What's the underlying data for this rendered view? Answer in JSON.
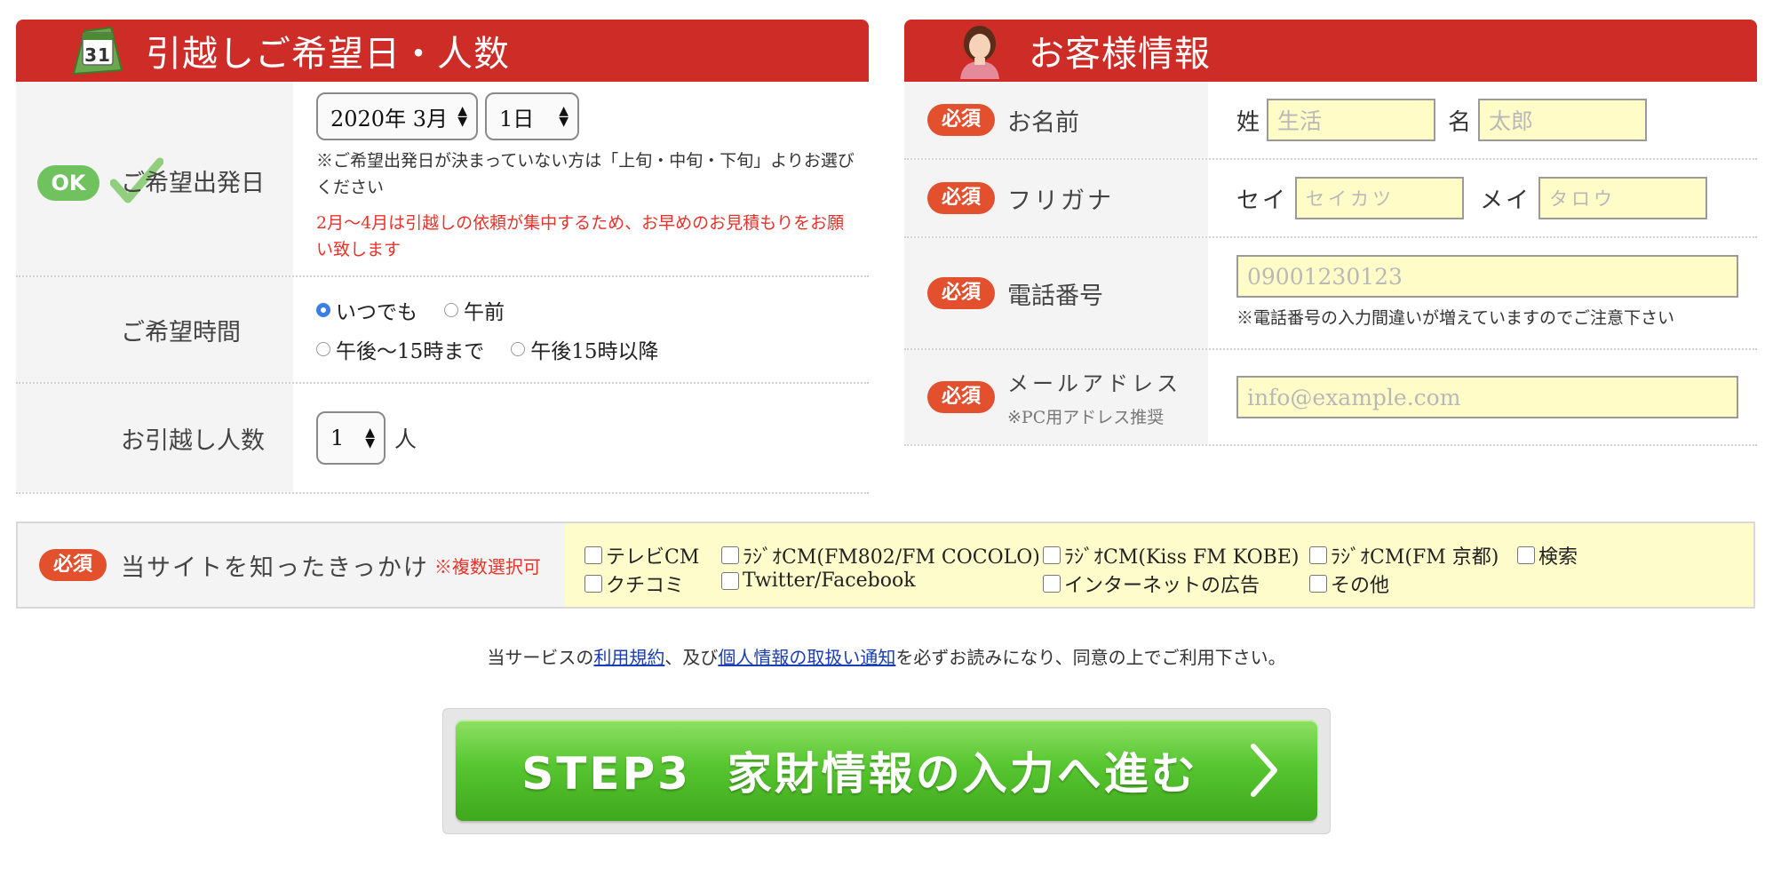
{
  "move": {
    "title": "引越しご希望日・人数",
    "departure": {
      "label": "ご希望出発日",
      "ok_badge": "OK",
      "year_month": "2020年 3月",
      "day": "1日",
      "note": "※ご希望出発日が決まっていない方は「上旬・中旬・下旬」よりお選びください",
      "warning": "2月〜4月は引越しの依頼が集中するため、お早めのお見積もりをお願い致します"
    },
    "time": {
      "label": "ご希望時間",
      "options": [
        "いつでも",
        "午前",
        "午後〜15時まで",
        "午後15時以降"
      ],
      "selected": "いつでも"
    },
    "people": {
      "label": "お引越し人数",
      "value": "1",
      "unit": "人"
    }
  },
  "customer": {
    "title": "お客様情報",
    "required": "必須",
    "name": {
      "label": "お名前",
      "last_label": "姓",
      "last_placeholder": "生活",
      "first_label": "名",
      "first_placeholder": "太郎"
    },
    "kana": {
      "label": "フリガナ",
      "last_label": "セイ",
      "last_placeholder": "セイカツ",
      "first_label": "メイ",
      "first_placeholder": "タロウ"
    },
    "phone": {
      "label": "電話番号",
      "placeholder": "09001230123",
      "note": "※電話番号の入力間違いが増えていますのでご注意下さい"
    },
    "email": {
      "label": "メールアドレス",
      "sublabel": "※PC用アドレス推奨",
      "placeholder": "info@example.com"
    }
  },
  "source": {
    "required": "必須",
    "label": "当サイトを知ったきっかけ",
    "multi": "※複数選択可",
    "options": [
      "テレビCM",
      "ﾗｼﾞｵCM(FM802/FM COCOLO)",
      "ﾗｼﾞｵCM(Kiss FM KOBE)",
      "ﾗｼﾞｵCM(FM 京都)",
      "検索",
      "クチコミ",
      "Twitter/Facebook",
      "インターネットの広告",
      "その他"
    ]
  },
  "agreement": {
    "prefix": "当サービスの",
    "terms_link": "利用規約",
    "middle": "、及び",
    "privacy_link": "個人情報の取扱い通知",
    "suffix": "を必ずお読みになり、同意の上でご利用下さい。"
  },
  "submit": {
    "label": "STEP3  家財情報の入力へ進む"
  },
  "colors": {
    "header_red": "#cd2c27",
    "required_badge": "#e2502e",
    "input_yellow": "#fffcc8",
    "button_green": "#4cb826",
    "link_blue": "#1a3fb5",
    "radio_blue": "#3a7ee6"
  }
}
